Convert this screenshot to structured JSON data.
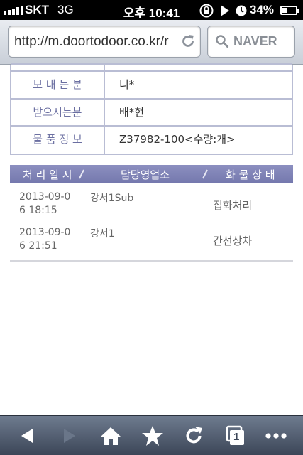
{
  "status_bar": {
    "carrier": "SKT",
    "network": "3G",
    "time": "오후 10:41",
    "battery_percent": "34%",
    "battery_level": 0.34,
    "icons": [
      "signal-icon",
      "lock-rotation-icon",
      "play-icon",
      "alarm-icon",
      "battery-icon"
    ]
  },
  "browser": {
    "url": "http://m.doortodoor.co.kr/r",
    "search_engine": "NAVER",
    "icons": [
      "reload-icon",
      "search-icon"
    ]
  },
  "shipment_info": {
    "rows": [
      {
        "label": "보 내 는 분",
        "value": "니*"
      },
      {
        "label": "받으시는분",
        "value": "배*현"
      },
      {
        "label": "물 품 정 보",
        "value": "Z37982-100<수량:개>"
      }
    ]
  },
  "tracking": {
    "headers": {
      "date": "처 리 일 시",
      "branch": "담당영업소",
      "status": "화 물 상 태"
    },
    "rows": [
      {
        "date": "2013-09-06 18:15",
        "branch": "강서1Sub",
        "status": "집화처리"
      },
      {
        "date": "2013-09-06 21:51",
        "branch": "강서1",
        "status": "간선상차"
      }
    ]
  },
  "toolbar": {
    "buttons": [
      "back-icon",
      "forward-icon",
      "home-icon",
      "bookmark-star-icon",
      "reload-icon",
      "pages-icon",
      "more-icon"
    ],
    "page_count": "1"
  },
  "colors": {
    "header_accent": "#7c80b5",
    "label_text": "#6b6fa1",
    "border": "#b9bdd4"
  }
}
